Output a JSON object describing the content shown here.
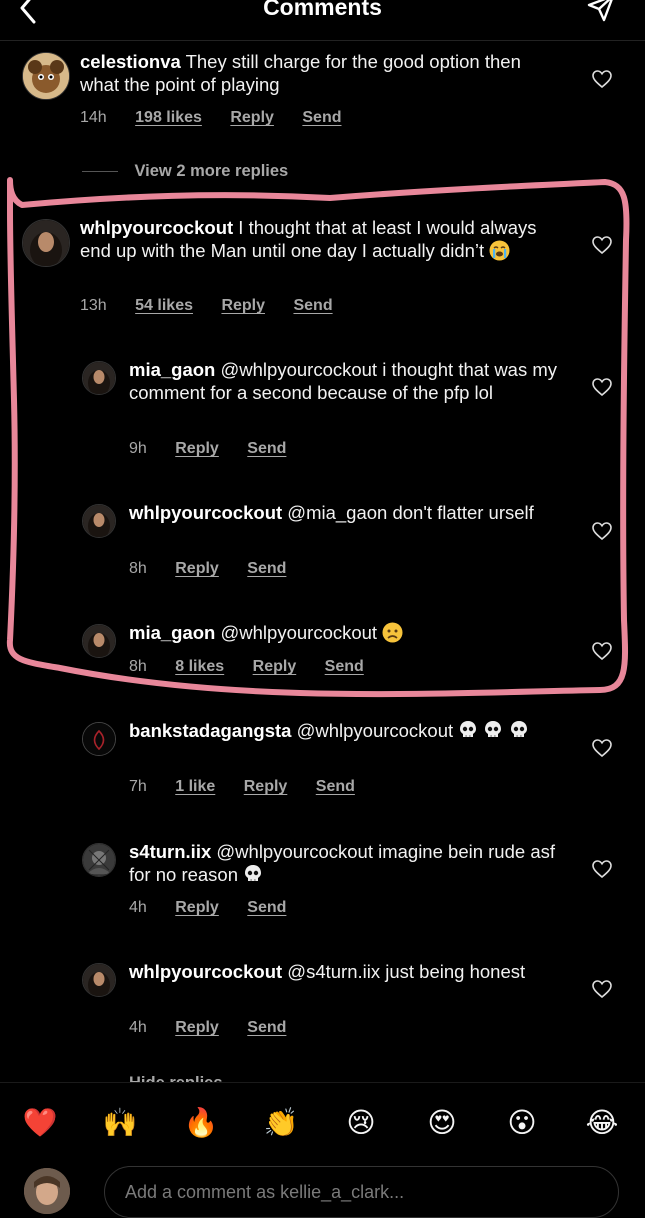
{
  "header": {
    "title": "Comments"
  },
  "comments": [
    {
      "user": "celestionva",
      "text": "They still charge for the good option then what the point of playing",
      "time": "14h",
      "likes": "198 likes",
      "reply": "Reply",
      "send": "Send"
    },
    {
      "user": "whlpyourcockout",
      "text": "I thought that at least I would always end up with the Man until one day I actually didn’t",
      "time": "13h",
      "likes": "54 likes",
      "reply": "Reply",
      "send": "Send"
    },
    {
      "user": "mia_gaon",
      "text": "@whlpyourcockout i thought that was my comment for a second because of the pfp lol",
      "time": "9h",
      "reply": "Reply",
      "send": "Send"
    },
    {
      "user": "whlpyourcockout",
      "text": "@mia_gaon don't flatter urself",
      "time": "8h",
      "reply": "Reply",
      "send": "Send"
    },
    {
      "user": "mia_gaon",
      "text": "@whlpyourcockout",
      "time": "8h",
      "likes": "8 likes",
      "reply": "Reply",
      "send": "Send"
    },
    {
      "user": "bankstadagangsta",
      "text": "@whlpyourcockout",
      "time": "7h",
      "likes": "1 like",
      "reply": "Reply",
      "send": "Send"
    },
    {
      "user": "s4turn.iix",
      "text": "@whlpyourcockout imagine bein rude asf for no reason",
      "time": "4h",
      "reply": "Reply",
      "send": "Send"
    },
    {
      "user": "whlpyourcockout",
      "text": "@s4turn.iix just being honest",
      "time": "4h",
      "reply": "Reply",
      "send": "Send"
    }
  ],
  "view_more": "View 2 more replies",
  "hide_replies": "Hide replies",
  "reactions": [
    "❤️",
    "🙌",
    "🔥",
    "👏",
    "😢",
    "😍",
    "😮",
    "😂"
  ],
  "composer": {
    "placeholder": "Add a comment as kellie_a_clark..."
  },
  "colors": {
    "highlight": "#e8879a",
    "background": "#000000"
  }
}
